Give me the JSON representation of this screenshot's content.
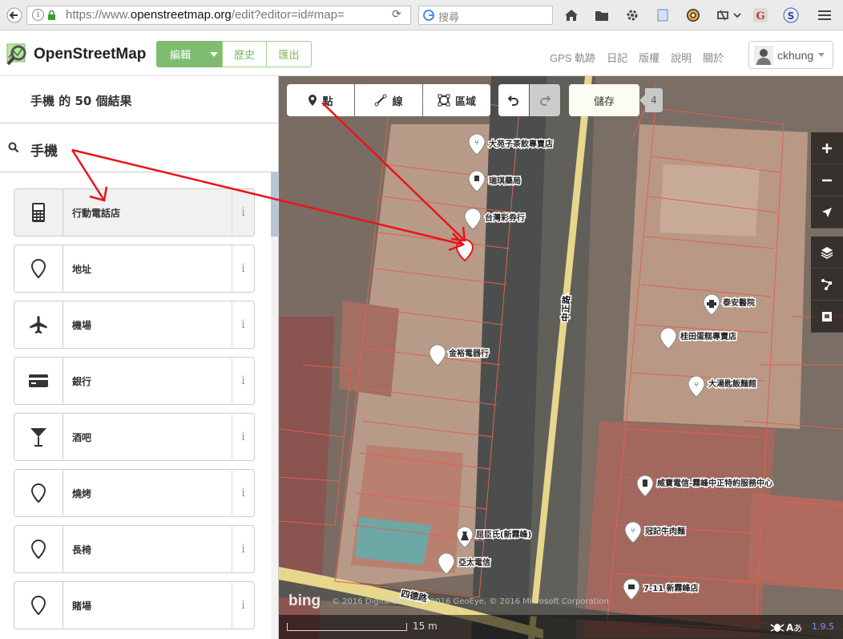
{
  "browser": {
    "url_prefix": "https://www.",
    "url_domain": "openstreetmap.org",
    "url_rest": "/edit?editor=id#map=",
    "search_placeholder": "搜尋"
  },
  "header": {
    "brand": "OpenStreetMap",
    "edit_label": "編輯",
    "history_label": "歷史",
    "export_label": "匯出",
    "nav": [
      "GPS 軌跡",
      "日記",
      "版權",
      "說明",
      "關於"
    ],
    "username": "ckhung"
  },
  "sidebar": {
    "result_title": "手機 的 50 個結果",
    "search_query": "手機",
    "presets": [
      {
        "label": "行動電話店",
        "icon": "mobile-phone-icon"
      },
      {
        "label": "地址",
        "icon": "map-pin-icon"
      },
      {
        "label": "機場",
        "icon": "airplane-icon"
      },
      {
        "label": "銀行",
        "icon": "credit-card-icon"
      },
      {
        "label": "酒吧",
        "icon": "cocktail-glass-icon"
      },
      {
        "label": "燒烤",
        "icon": "map-pin-icon"
      },
      {
        "label": "長椅",
        "icon": "map-pin-icon"
      },
      {
        "label": "賭場",
        "icon": "map-pin-icon"
      }
    ],
    "info_glyph": "i"
  },
  "editor": {
    "point_label": "點",
    "line_label": "線",
    "area_label": "區域",
    "save_label": "儲存",
    "edit_count": "4",
    "scale_label": "15 m",
    "version": "1.9.5",
    "bing_label": "bing",
    "attribution": "© 2016 DigitalGlobe, © 2016 GeoEye, © 2016 Microsoft Corporation"
  },
  "map_labels": {
    "street_zhongzheng": "中正路",
    "street_side": "四德路",
    "pois": [
      "大苑子茶飲專賣店",
      "瑞琪藥局",
      "台灣彩券行",
      "金裕電器行",
      "屈臣氏(新霧峰)",
      "亞太電信",
      "泰安醫院",
      "桂田蛋糕專賣店",
      "大湯匙飯麵館",
      "威寶電信-霧峰中正特約服務中心",
      "冠記牛肉麵",
      "7-11 新霧峰店"
    ]
  },
  "colors": {
    "osm_green": "#7ebc6f",
    "annotation_red": "#e8151b",
    "building_outline": "#e06150"
  }
}
